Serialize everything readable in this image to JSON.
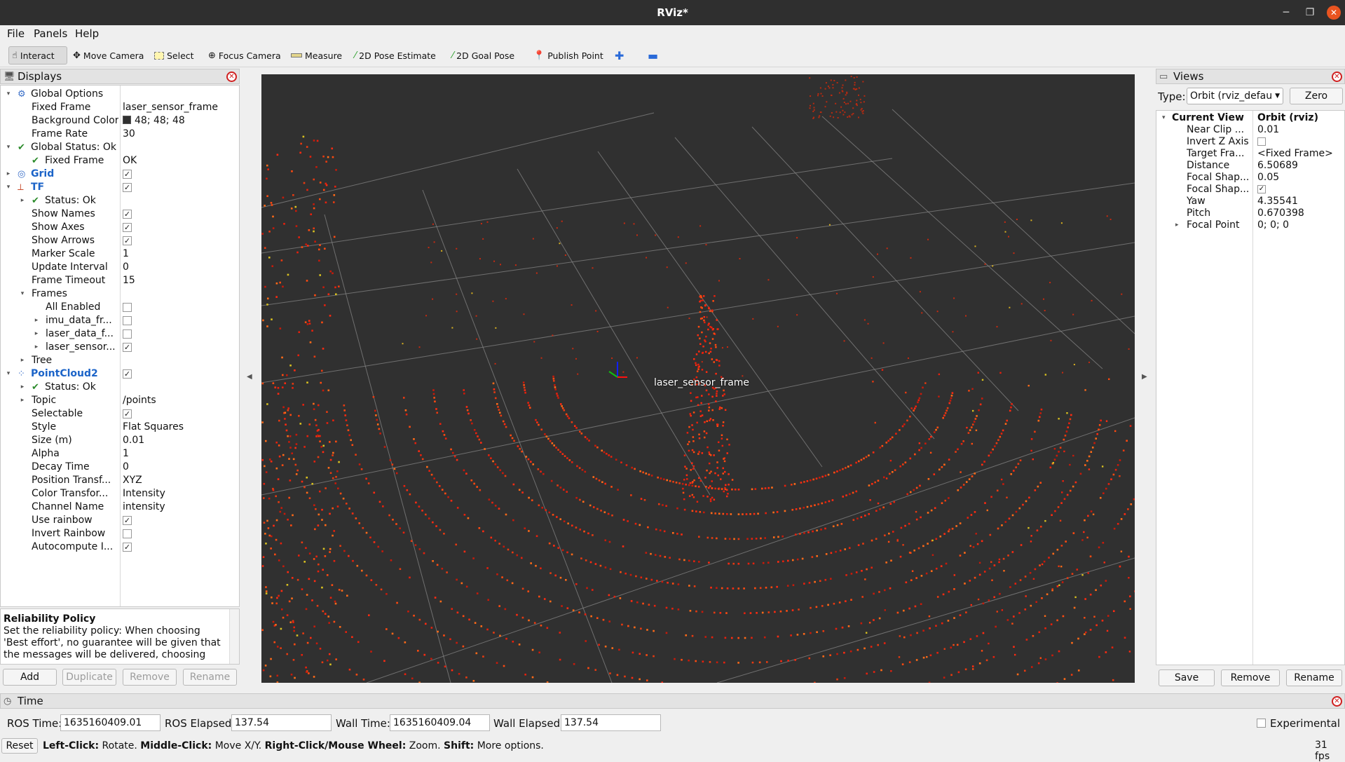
{
  "window": {
    "title": "RViz*"
  },
  "menu": [
    "File",
    "Panels",
    "Help"
  ],
  "toolbar": [
    {
      "label": "Interact",
      "icon": "interact-icon"
    },
    {
      "label": "Move Camera",
      "icon": "move-camera-icon"
    },
    {
      "label": "Select",
      "icon": "select-icon"
    },
    {
      "label": "Focus Camera",
      "icon": "focus-camera-icon"
    },
    {
      "label": "Measure",
      "icon": "measure-icon"
    },
    {
      "label": "2D Pose Estimate",
      "icon": "pose-estimate-icon"
    },
    {
      "label": "2D Goal Pose",
      "icon": "goal-pose-icon"
    },
    {
      "label": "Publish Point",
      "icon": "publish-point-icon"
    }
  ],
  "displays": {
    "title": "Displays",
    "rows": [
      {
        "label": "Global Options",
        "value": ""
      },
      {
        "label": "Fixed Frame",
        "value": "laser_sensor_frame"
      },
      {
        "label": "Background Color",
        "value": "48; 48; 48",
        "swatch": "#303030"
      },
      {
        "label": "Frame Rate",
        "value": "30"
      },
      {
        "label": "Global Status: Ok",
        "value": ""
      },
      {
        "label": "Fixed Frame",
        "value": "OK"
      },
      {
        "label": "Grid",
        "value": ""
      },
      {
        "label": "TF",
        "value": ""
      },
      {
        "label": "Status: Ok",
        "value": ""
      },
      {
        "label": "Show Names",
        "value": ""
      },
      {
        "label": "Show Axes",
        "value": ""
      },
      {
        "label": "Show Arrows",
        "value": ""
      },
      {
        "label": "Marker Scale",
        "value": "1"
      },
      {
        "label": "Update Interval",
        "value": "0"
      },
      {
        "label": "Frame Timeout",
        "value": "15"
      },
      {
        "label": "Frames",
        "value": ""
      },
      {
        "label": "All Enabled",
        "value": ""
      },
      {
        "label": "imu_data_fr...",
        "value": ""
      },
      {
        "label": "laser_data_f...",
        "value": ""
      },
      {
        "label": "laser_sensor...",
        "value": ""
      },
      {
        "label": "Tree",
        "value": ""
      },
      {
        "label": "PointCloud2",
        "value": ""
      },
      {
        "label": "Status: Ok",
        "value": ""
      },
      {
        "label": "Topic",
        "value": "/points"
      },
      {
        "label": "Selectable",
        "value": ""
      },
      {
        "label": "Style",
        "value": "Flat Squares"
      },
      {
        "label": "Size (m)",
        "value": "0.01"
      },
      {
        "label": "Alpha",
        "value": "1"
      },
      {
        "label": "Decay Time",
        "value": "0"
      },
      {
        "label": "Position Transf...",
        "value": "XYZ"
      },
      {
        "label": "Color Transfor...",
        "value": "Intensity"
      },
      {
        "label": "Channel Name",
        "value": "intensity"
      },
      {
        "label": "Use rainbow",
        "value": ""
      },
      {
        "label": "Invert Rainbow",
        "value": ""
      },
      {
        "label": "Autocompute I...",
        "value": ""
      }
    ],
    "checks": {
      "grid": true,
      "tf": true,
      "show_names": true,
      "show_axes": true,
      "show_arrows": true,
      "all_enabled": false,
      "imu": false,
      "laser_data": false,
      "laser_sensor": true,
      "pointcloud2": true,
      "selectable": true,
      "use_rainbow": true,
      "invert_rainbow": false,
      "autocompute": true
    },
    "help_title": "Reliability Policy",
    "help_text": "Set the reliability policy: When choosing 'Best effort', no guarantee will be given that the messages will be delivered, choosing",
    "buttons": {
      "add": "Add",
      "duplicate": "Duplicate",
      "remove": "Remove",
      "rename": "Rename"
    }
  },
  "viewport": {
    "frame_label": "laser_sensor_frame",
    "background": "#303030"
  },
  "views": {
    "title": "Views",
    "type_label": "Type:",
    "type_value": "Orbit (rviz_defau",
    "zero_label": "Zero",
    "rows": [
      {
        "label": "Current View",
        "value": "Orbit (rviz)"
      },
      {
        "label": "Near Clip ...",
        "value": "0.01"
      },
      {
        "label": "Invert Z Axis",
        "value": ""
      },
      {
        "label": "Target Fra...",
        "value": "<Fixed Frame>"
      },
      {
        "label": "Distance",
        "value": "6.50689"
      },
      {
        "label": "Focal Shap...",
        "value": "0.05"
      },
      {
        "label": "Focal Shap...",
        "value": ""
      },
      {
        "label": "Yaw",
        "value": "4.35541"
      },
      {
        "label": "Pitch",
        "value": "0.670398"
      },
      {
        "label": "Focal Point",
        "value": "0; 0; 0"
      }
    ],
    "checks": {
      "invert_z": false,
      "focal_shape_fixed": true
    },
    "buttons": {
      "save": "Save",
      "remove": "Remove",
      "rename": "Rename"
    }
  },
  "time": {
    "title": "Time",
    "ros_time_label": "ROS Time:",
    "ros_time": "1635160409.01",
    "ros_elapsed_label": "ROS Elapsed:",
    "ros_elapsed": "137.54",
    "wall_time_label": "Wall Time:",
    "wall_time": "1635160409.04",
    "wall_elapsed_label": "Wall Elapsed:",
    "wall_elapsed": "137.54",
    "experimental_label": "Experimental"
  },
  "status": {
    "reset_label": "Reset",
    "hint_parts": [
      {
        "bold": "Left-Click:",
        "text": " Rotate. "
      },
      {
        "bold": "Middle-Click:",
        "text": " Move X/Y. "
      },
      {
        "bold": "Right-Click/Mouse Wheel:",
        "text": " Zoom. "
      },
      {
        "bold": "Shift:",
        "text": " More options."
      }
    ],
    "fps": "31 fps"
  }
}
